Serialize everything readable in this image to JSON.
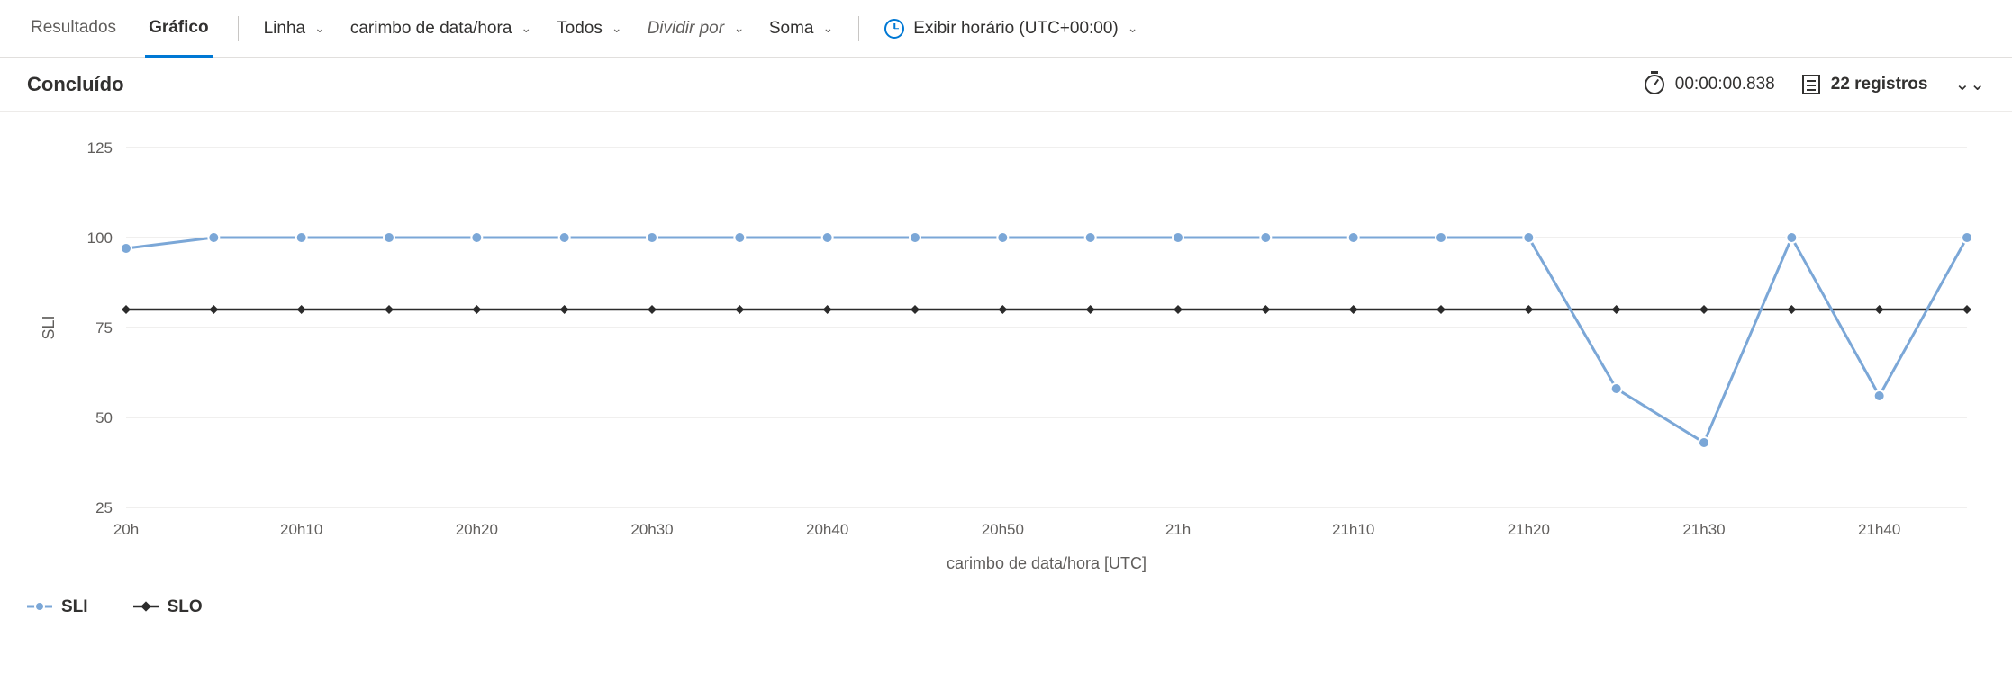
{
  "tabs": {
    "results": "Resultados",
    "chart": "Gráfico"
  },
  "toolbar": {
    "chart_type": "Linha",
    "x_field": "carimbo de data/hora",
    "filter": "Todos",
    "split_by": "Dividir por",
    "aggregation": "Soma",
    "timezone": "Exibir horário (UTC+00:00)"
  },
  "status": {
    "title": "Concluído",
    "elapsed": "00:00:00.838",
    "records": "22 registros"
  },
  "legend": {
    "sli": "SLI",
    "slo": "SLO"
  },
  "chart_data": {
    "type": "line",
    "xlabel": "carimbo de data/hora [UTC]",
    "ylabel": "SLI",
    "ylim": [
      25,
      125
    ],
    "yticks": [
      25,
      50,
      75,
      100,
      125
    ],
    "x_tick_labels": [
      "20h",
      "20h10",
      "20h20",
      "20h30",
      "20h40",
      "20h50",
      "21h",
      "21h10",
      "21h20",
      "21h30",
      "21h40"
    ],
    "categories": [
      "20:00",
      "20:05",
      "20:10",
      "20:15",
      "20:20",
      "20:25",
      "20:30",
      "20:35",
      "20:40",
      "20:45",
      "20:50",
      "20:55",
      "21:00",
      "21:05",
      "21:10",
      "21:15",
      "21:20",
      "21:25",
      "21:30",
      "21:35",
      "21:40",
      "21:45"
    ],
    "series": [
      {
        "name": "SLI",
        "values": [
          97,
          100,
          100,
          100,
          100,
          100,
          100,
          100,
          100,
          100,
          100,
          100,
          100,
          100,
          100,
          100,
          100,
          58,
          43,
          100,
          56,
          100
        ]
      },
      {
        "name": "SLO",
        "values": [
          80,
          80,
          80,
          80,
          80,
          80,
          80,
          80,
          80,
          80,
          80,
          80,
          80,
          80,
          80,
          80,
          80,
          80,
          80,
          80,
          80,
          80
        ]
      }
    ]
  }
}
